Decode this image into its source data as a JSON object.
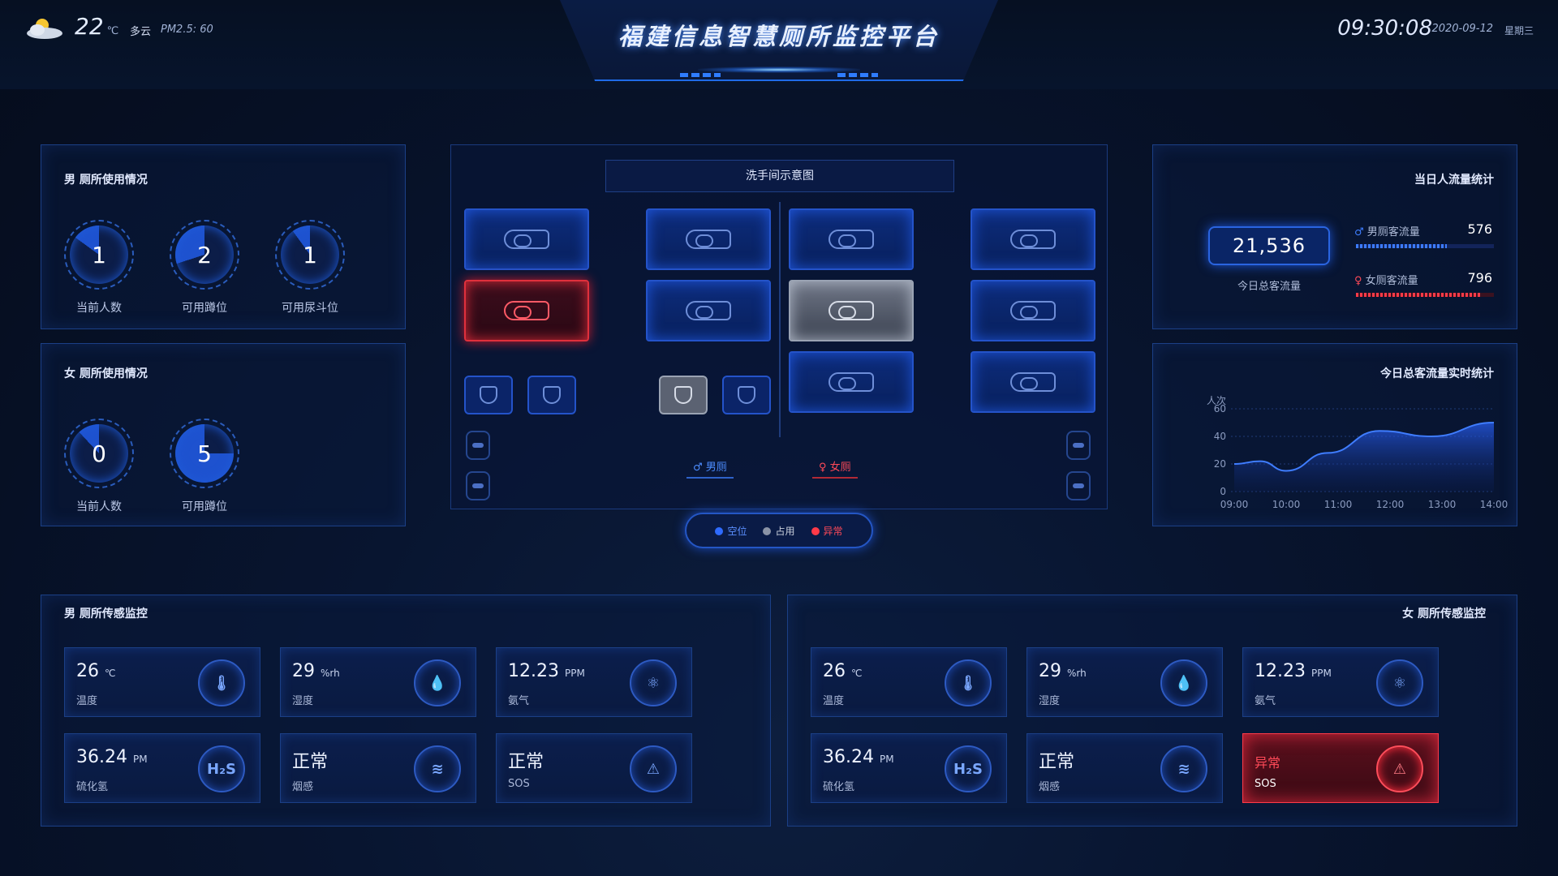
{
  "header": {
    "title": "福建信息智慧厕所监控平台",
    "temperature": "22",
    "temp_unit": "℃",
    "weather": "多云",
    "pm_label": "PM2.5:",
    "pm_value": "60",
    "time": "09:30:08",
    "date": "2020-09-12",
    "weekday": "星期三"
  },
  "male_usage": {
    "title": "男 厕所使用情况",
    "gauges": [
      {
        "value": "1",
        "label": "当前人数",
        "fill": 0.15
      },
      {
        "value": "2",
        "label": "可用蹲位",
        "fill": 0.3
      },
      {
        "value": "1",
        "label": "可用尿斗位",
        "fill": 0.1
      }
    ]
  },
  "female_usage": {
    "title": "女 厕所使用情况",
    "gauges": [
      {
        "value": "0",
        "label": "当前人数",
        "fill": 0.12
      },
      {
        "value": "5",
        "label": "可用蹲位",
        "fill": 0.75
      }
    ]
  },
  "center": {
    "title": "洗手间示意图",
    "male_label": "男厕",
    "female_label": "女厕",
    "legend": [
      {
        "label": "空位",
        "color": "#2f6bff"
      },
      {
        "label": "占用",
        "color": "#8a93a6"
      },
      {
        "label": "异常",
        "color": "#ff3a48"
      }
    ]
  },
  "flow": {
    "title": "当日人流量统计",
    "total": "21,536",
    "total_label": "今日总客流量",
    "male_label": "男厕客流量",
    "male_value": "576",
    "female_label": "女厕客流量",
    "female_value": "796"
  },
  "realtime": {
    "title": "今日总客流量实时统计"
  },
  "chart_data": {
    "type": "area",
    "ylabel": "人次",
    "x": [
      "09:00",
      "10:00",
      "11:00",
      "12:00",
      "13:00",
      "14:00"
    ],
    "ylim": [
      0,
      60
    ],
    "yticks": [
      0,
      20,
      40,
      60
    ],
    "series": [
      {
        "values": [
          20,
          22,
          15,
          28,
          44,
          40,
          50
        ]
      }
    ],
    "x_points": [
      0,
      0.5,
      1.0,
      1.8,
      2.8,
      3.8,
      5.0
    ]
  },
  "male_sensor": {
    "title": "男 厕所传感监控",
    "cards": [
      {
        "value": "26",
        "unit": "℃",
        "label": "温度",
        "icon": "thermometer-icon",
        "glyph": "🌡"
      },
      {
        "value": "29",
        "unit": "%rh",
        "label": "湿度",
        "icon": "droplet-icon",
        "glyph": "💧"
      },
      {
        "value": "12.23",
        "unit": "PPM",
        "label": "氨气",
        "icon": "molecule-icon",
        "glyph": "⚛"
      },
      {
        "value": "36.24",
        "unit": "PM",
        "label": "硫化氢",
        "icon": "h2s-icon",
        "glyph": "H₂S"
      },
      {
        "value": "正常",
        "unit": "",
        "label": "烟感",
        "icon": "smoke-detector-icon",
        "glyph": "≋"
      },
      {
        "value": "正常",
        "unit": "",
        "label": "SOS",
        "icon": "alarm-icon",
        "glyph": "⚠"
      }
    ]
  },
  "female_sensor": {
    "title": "女 厕所传感监控",
    "cards": [
      {
        "value": "26",
        "unit": "℃",
        "label": "温度",
        "icon": "thermometer-icon",
        "glyph": "🌡"
      },
      {
        "value": "29",
        "unit": "%rh",
        "label": "湿度",
        "icon": "droplet-icon",
        "glyph": "💧"
      },
      {
        "value": "12.23",
        "unit": "PPM",
        "label": "氨气",
        "icon": "molecule-icon",
        "glyph": "⚛"
      },
      {
        "value": "36.24",
        "unit": "PM",
        "label": "硫化氢",
        "icon": "h2s-icon",
        "glyph": "H₂S"
      },
      {
        "value": "正常",
        "unit": "",
        "label": "烟感",
        "icon": "smoke-detector-icon",
        "glyph": "≋"
      },
      {
        "value": "异常",
        "unit": "",
        "label": "SOS",
        "icon": "alarm-icon",
        "glyph": "⚠",
        "alert": true
      }
    ]
  }
}
